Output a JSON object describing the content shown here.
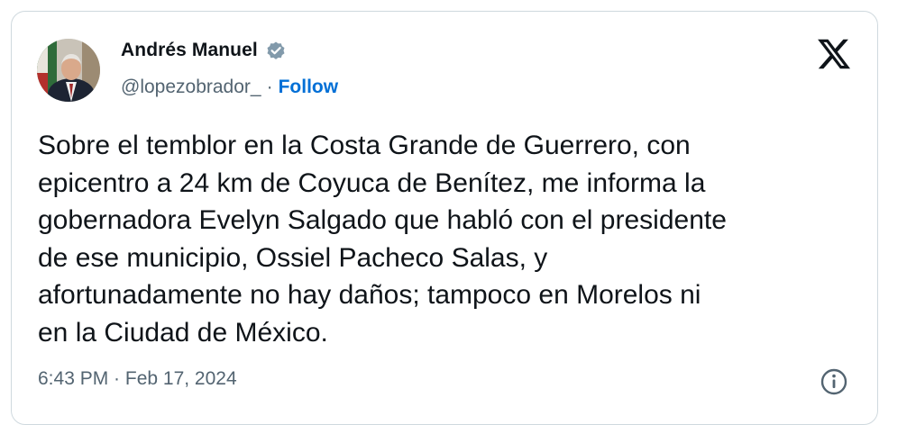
{
  "author": {
    "display_name": "Andrés Manuel",
    "handle": "@lopezobrador_",
    "separator": "·",
    "follow_label": "Follow",
    "verified": true,
    "avatar_icon": "profile-photo"
  },
  "platform": {
    "logo_icon": "x-logo-icon"
  },
  "tweet": {
    "text": "Sobre el temblor en la Costa Grande de Guerrero, con\nepicentro a 24 km de Coyuca de Benítez, me informa la\ngobernadora Evelyn Salgado que habló con el presidente\nde ese municipio, Ossiel Pacheco Salas, y\nafortunadamente no hay daños; tampoco en Morelos ni\nen la Ciudad de México.",
    "timestamp": "6:43 PM · Feb 17, 2024"
  },
  "colors": {
    "text_primary": "#0f1419",
    "text_secondary": "#536471",
    "follow_link": "#006fd6",
    "verified_badge": "#829aab",
    "border": "#cfd9de"
  }
}
